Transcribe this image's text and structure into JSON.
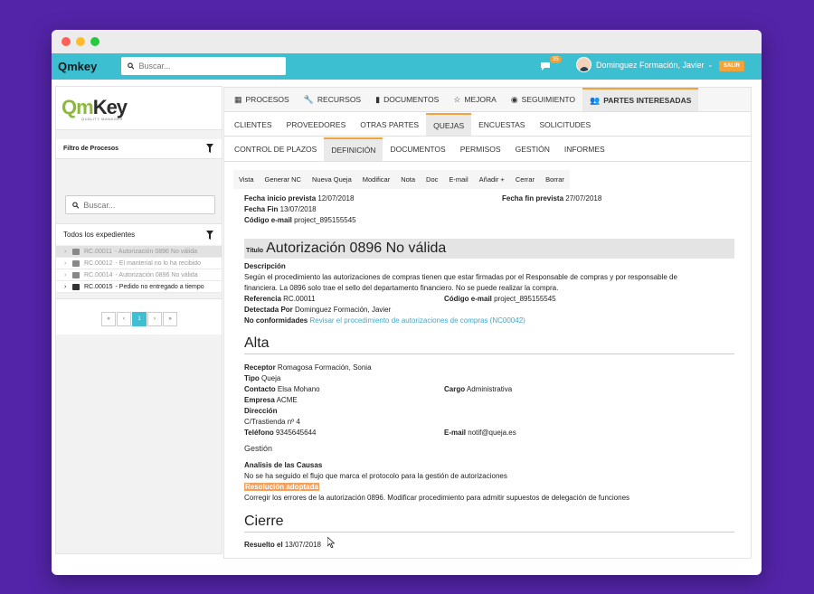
{
  "topbar": {
    "brand": "Qmkey",
    "search_placeholder": "Buscar...",
    "notifications": "35",
    "user_name": "Dominguez Formación, Javier",
    "exit_label": "SALIR"
  },
  "sidebar": {
    "logo_text_q": "Qm",
    "logo_text_key": "Key",
    "logo_sub": "QUALITY MANAGER",
    "filter_title": "Filtro de Procesos",
    "search_placeholder": "Buscar...",
    "list_title": "Todos los expedientes",
    "items": [
      {
        "code": "RC.00011",
        "text": "- Autorización 0896 No válida"
      },
      {
        "code": "RC.00012",
        "text": "- El manterial no lo ha recibido"
      },
      {
        "code": "RC.00014",
        "text": "- Autorización 0896 No válida"
      },
      {
        "code": "RC.00015",
        "text": "- Pedido no entregado a tiempo"
      }
    ],
    "pager": [
      "«",
      "‹",
      "1",
      "›",
      "»"
    ]
  },
  "tabs_primary": [
    {
      "icon": "grid-icon",
      "glyph": "▦",
      "label": "PROCESOS"
    },
    {
      "icon": "wrench-icon",
      "glyph": "🔧",
      "label": "RECURSOS"
    },
    {
      "icon": "document-icon",
      "glyph": "▮",
      "label": "DOCUMENTOS"
    },
    {
      "icon": "star-icon",
      "glyph": "☆",
      "label": "MEJORA"
    },
    {
      "icon": "eye-icon",
      "glyph": "◉",
      "label": "SEGUIMIENTO"
    },
    {
      "icon": "users-icon",
      "glyph": "👥",
      "label": "PARTES INTERESADAS"
    }
  ],
  "tabs_secondary": [
    "CLIENTES",
    "PROVEEDORES",
    "OTRAS PARTES",
    "QUEJAS",
    "ENCUESTAS",
    "SOLICITUDES"
  ],
  "tabs_tertiary": [
    "CONTROL DE PLAZOS",
    "DEFINICIÓN",
    "DOCUMENTOS",
    "PERMISOS",
    "GESTIÓN",
    "INFORMES"
  ],
  "toolbar": [
    "Vista",
    "Generar NC",
    "Nueva Queja",
    "Modificar",
    "Nota",
    "Doc",
    "E-mail",
    "Añadir +",
    "Cerrar",
    "Borrar"
  ],
  "detail": {
    "fecha_inicio_label": "Fecha inicio prevista",
    "fecha_inicio": "12/07/2018",
    "fecha_fin_prev_label": "Fecha fin prevista",
    "fecha_fin_prev": "27/07/2018",
    "fecha_fin_label": "Fecha Fin",
    "fecha_fin": "13/07/2018",
    "codigo_email_label": "Código e-mail",
    "codigo_email": "project_895155545",
    "titulo_label": "Título",
    "titulo": "Autorización 0896 No válida",
    "descripcion_label": "Descripción",
    "descripcion_1": "Según el procedimiento las autorizaciones de compras tienen que estar firmadas por el Responsable de compras y por responsable de",
    "descripcion_2": "financiera. La 0896 solo trae el sello del departamento financiero. No se puede realizar la compra.",
    "referencia_label": "Referencia",
    "referencia": "RC.00011",
    "codigo_email2_label": "Código e-mail",
    "codigo_email2": "project_895155545",
    "detectada_label": "Detectada Por",
    "detectada": "Dominguez Formación, Javier",
    "nc_label": "No conformidades",
    "nc_link": "Revisar el procedimiento de autorizaciones de compras (NC00042)"
  },
  "alta": {
    "heading": "Alta",
    "receptor_label": "Receptor",
    "receptor": "Romagosa Formación, Sonia",
    "tipo_label": "Tipo",
    "tipo": "Queja",
    "contacto_label": "Contacto",
    "contacto": "Elsa Mohano",
    "cargo_label": "Cargo",
    "cargo": "Administrativa",
    "empresa_label": "Empresa",
    "empresa": "ACME",
    "direccion_label": "Dirección",
    "direccion": "C/Trastienda nº 4",
    "telefono_label": "Teléfono",
    "telefono": "9345645644",
    "email_label": "E-mail",
    "email": "notif@queja.es"
  },
  "gestion": {
    "heading": "Gestión",
    "analisis_label": "Analisis de las Causas",
    "analisis": "No se ha seguido el flujo que marca el protocolo para la gestión de autorizaciones",
    "resolucion_label": "Resolución adoptada",
    "resolucion": "Corregir los errores de la autorización 0896. Modificar procedimiento para admitir supuestos de delegación de funciones"
  },
  "cierre": {
    "heading": "Cierre",
    "resuelto_label": "Resuelto el",
    "resuelto": "13/07/2018"
  },
  "colors": {
    "background": "#5324a8",
    "appbar": "#3dbfd2",
    "accent": "#f2a33a",
    "link": "#41a9c8",
    "highlight": "#f3a15c"
  }
}
